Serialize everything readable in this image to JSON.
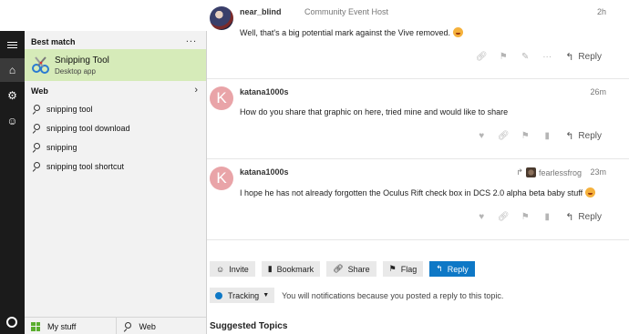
{
  "forum": {
    "posts": [
      {
        "author": "near_blind",
        "role": "Community Event Host",
        "time": "2h",
        "body": "Well, that's a big potential mark against the Vive removed.",
        "reply_label": "Reply"
      },
      {
        "author": "katana1000s",
        "avatar_letter": "K",
        "time": "26m",
        "body": "How do you share that graphic on here, tried mine and would like to share",
        "reply_label": "Reply"
      },
      {
        "author": "katana1000s",
        "avatar_letter": "K",
        "time": "23m",
        "reply_to": "fearlessfrog",
        "body": "I hope he has not already forgotten the Oculus Rift check box in DCS 2.0 alpha beta baby stuff",
        "reply_label": "Reply"
      }
    ],
    "toolbar": {
      "invite": "Invite",
      "bookmark": "Bookmark",
      "share": "Share",
      "flag": "Flag",
      "reply": "Reply"
    },
    "tracking": {
      "label": "Tracking",
      "note": "You will notifications because you posted a reply to this topic."
    },
    "suggested_title": "Suggested Topics"
  },
  "start_menu": {
    "best_match_header": "Best match",
    "more": "...",
    "best_match": {
      "name": "Snipping Tool",
      "type": "Desktop app"
    },
    "web_header": "Web",
    "suggestions": [
      "snipping tool",
      "snipping tool download",
      "snipping",
      "snipping tool shortcut"
    ],
    "bottom_tabs": {
      "my_stuff": "My stuff",
      "web": "Web"
    }
  },
  "colors": {
    "accent_blue": "#0e78c6",
    "best_match_bg": "#d6ebb9",
    "rail_bg": "#1b1b1b"
  }
}
